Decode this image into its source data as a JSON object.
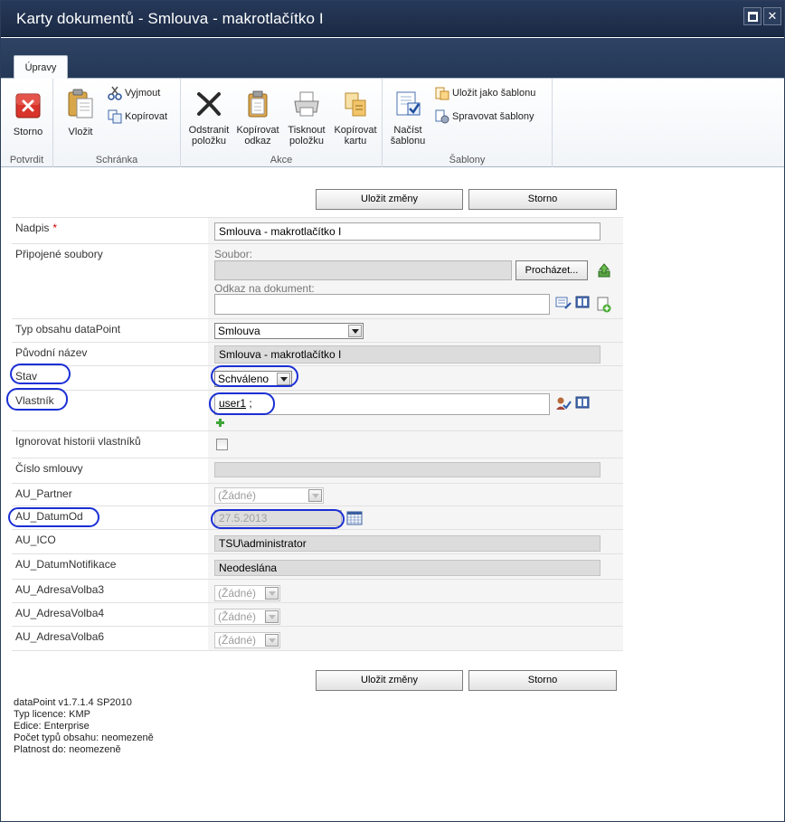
{
  "window": {
    "title": "Karty dokumentů - Smlouva - makrotlačítko I",
    "maximize_icon": "maximize-icon",
    "close_symbol": "✕"
  },
  "ribbon": {
    "tab": "Úpravy",
    "groups": {
      "potvrdit": {
        "label": "Potvrdit",
        "storno": "Storno"
      },
      "schranka": {
        "label": "Schránka",
        "vlozit": "Vložit",
        "vyjmout": "Vyjmout",
        "kopirovat": "Kopírovat"
      },
      "akce": {
        "label": "Akce",
        "odstranit": [
          "Odstranit",
          "položku"
        ],
        "kopirovat_odkaz": [
          "Kopírovat",
          "odkaz"
        ],
        "tisknout": [
          "Tisknout",
          "položku"
        ],
        "kopirovat_kartu": [
          "Kopírovat",
          "kartu"
        ]
      },
      "sablony": {
        "label": "Šablony",
        "nacist": [
          "Načíst",
          "šablonu"
        ],
        "ulozit_jako": "Uložit jako šablonu",
        "spravovat": "Spravovat šablony"
      }
    }
  },
  "buttons": {
    "save": "Uložit změny",
    "cancel": "Storno"
  },
  "form": {
    "nadpis": {
      "label": "Nadpis",
      "required_mark": "*",
      "value": "Smlouva - makrotlačítko I"
    },
    "pripojene": {
      "label": "Připojené soubory",
      "soubor_label": "Soubor:",
      "browse": "Procházet...",
      "odkaz_label": "Odkaz na dokument:"
    },
    "typ_obsahu": {
      "label": "Typ obsahu dataPoint",
      "value": "Smlouva"
    },
    "puvodni_nazev": {
      "label": "Původní název",
      "value": "Smlouva - makrotlačítko I"
    },
    "stav": {
      "label": "Stav",
      "value": "Schváleno"
    },
    "vlastnik": {
      "label": "Vlastník",
      "user": "user1",
      "suffix": " ;"
    },
    "ignorovat": {
      "label": "Ignorovat historii vlastníků",
      "checked": false
    },
    "cislo_smlouvy": {
      "label": "Číslo smlouvy",
      "value": ""
    },
    "au_partner": {
      "label": "AU_Partner",
      "value": "(Žádné)"
    },
    "au_datumod": {
      "label": "AU_DatumOd",
      "value": "27.5.2013"
    },
    "au_ico": {
      "label": "AU_ICO",
      "value": "TSU\\administrator"
    },
    "au_datumnotifikace": {
      "label": "AU_DatumNotifikace",
      "value": "Neodeslána"
    },
    "au_adresavolba3": {
      "label": "AU_AdresaVolba3",
      "value": "(Žádné)"
    },
    "au_adresavolba4": {
      "label": "AU_AdresaVolba4",
      "value": "(Žádné)"
    },
    "au_adresavolba6": {
      "label": "AU_AdresaVolba6",
      "value": "(Žádné)"
    }
  },
  "footer": [
    "dataPoint v1.7.1.4 SP2010",
    "Typ licence: KMP",
    "Edice: Enterprise",
    "Počet typů obsahu: neomezeně",
    "Platnost do: neomezeně"
  ],
  "colors": {
    "title_bar": "#1f3050",
    "highlight_oval": "#1a2fd6",
    "required": "#cc0000"
  }
}
